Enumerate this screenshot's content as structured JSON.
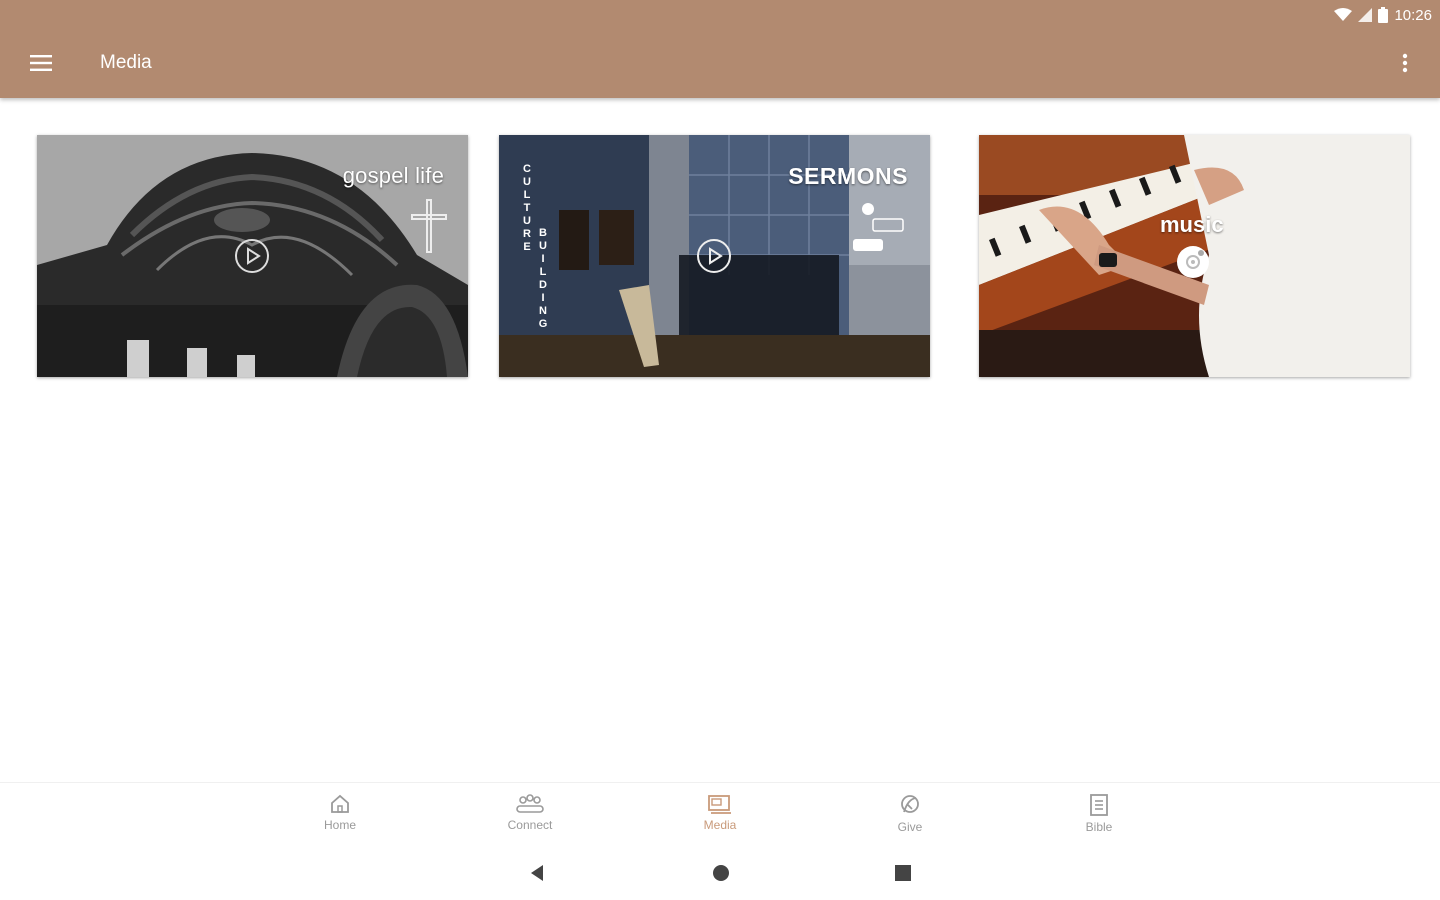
{
  "status_bar": {
    "time": "10:26"
  },
  "app_bar": {
    "title": "Media",
    "menu_icon": "hamburger-menu-icon",
    "overflow_icon": "more-vert-icon"
  },
  "cards": [
    {
      "label": "gospel life",
      "icon": "play-icon"
    },
    {
      "label": "SERMONS",
      "side_text_1": "CULTURE",
      "side_text_2": "BUILDING",
      "icon": "play-icon"
    },
    {
      "label": "music",
      "icon": "music-disc-icon"
    }
  ],
  "bottom_nav": [
    {
      "label": "Home",
      "icon": "home-icon",
      "active": false
    },
    {
      "label": "Connect",
      "icon": "people-icon",
      "active": false
    },
    {
      "label": "Media",
      "icon": "media-icon",
      "active": true
    },
    {
      "label": "Give",
      "icon": "give-icon",
      "active": false
    },
    {
      "label": "Bible",
      "icon": "bible-icon",
      "active": false
    }
  ],
  "colors": {
    "app_bar": "#b28a70",
    "active_nav": "#c99a7a",
    "inactive_nav": "#9a9a9a"
  }
}
